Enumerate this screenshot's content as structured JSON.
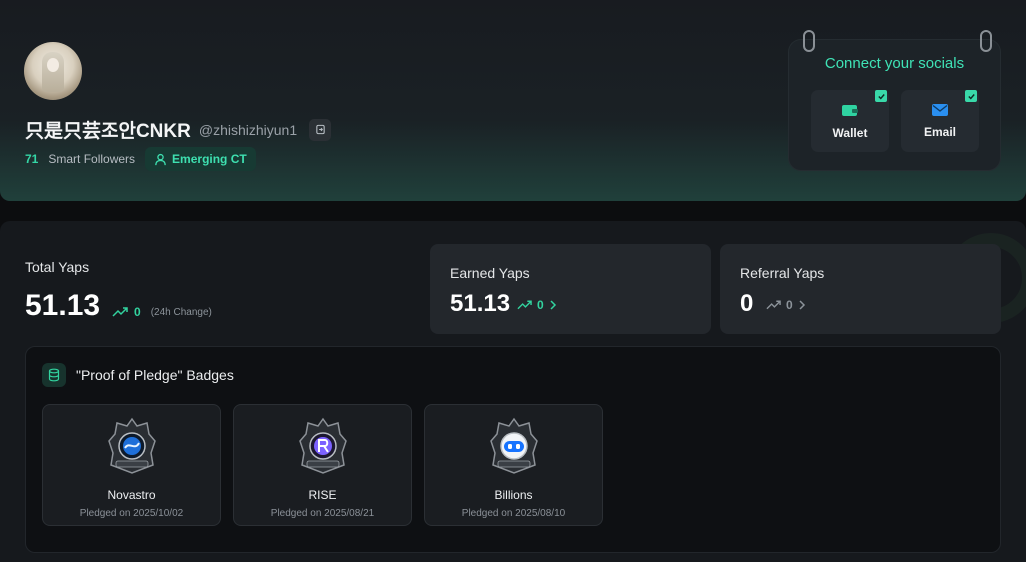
{
  "profile": {
    "display_name": "只是只芸조안CNKR",
    "handle": "@zhishizhiyun1",
    "smart_followers_count": "71",
    "smart_followers_label": "Smart Followers",
    "tier": "Emerging CT"
  },
  "socials": {
    "title": "Connect your socials",
    "items": [
      {
        "label": "Wallet",
        "icon": "wallet-icon",
        "connected": true
      },
      {
        "label": "Email",
        "icon": "mail-icon",
        "connected": true
      }
    ]
  },
  "stats": {
    "total": {
      "label": "Total Yaps",
      "value": "51.13",
      "change": "0",
      "change_note": "(24h Change)"
    },
    "earned": {
      "label": "Earned Yaps",
      "value": "51.13",
      "change": "0"
    },
    "referral": {
      "label": "Referral Yaps",
      "value": "0",
      "change": "0"
    }
  },
  "badges": {
    "title": "\"Proof of Pledge\" Badges",
    "items": [
      {
        "name": "Novastro",
        "date": "Pledged on 2025/10/02",
        "emblem_color": "#1e6fd9"
      },
      {
        "name": "RISE",
        "date": "Pledged on 2025/08/21",
        "emblem_color": "#7b61ff"
      },
      {
        "name": "Billions",
        "date": "Pledged on 2025/08/10",
        "emblem_color": "#1673ff"
      }
    ]
  },
  "colors": {
    "accent": "#32d39f",
    "background": "#0c0d0f"
  }
}
